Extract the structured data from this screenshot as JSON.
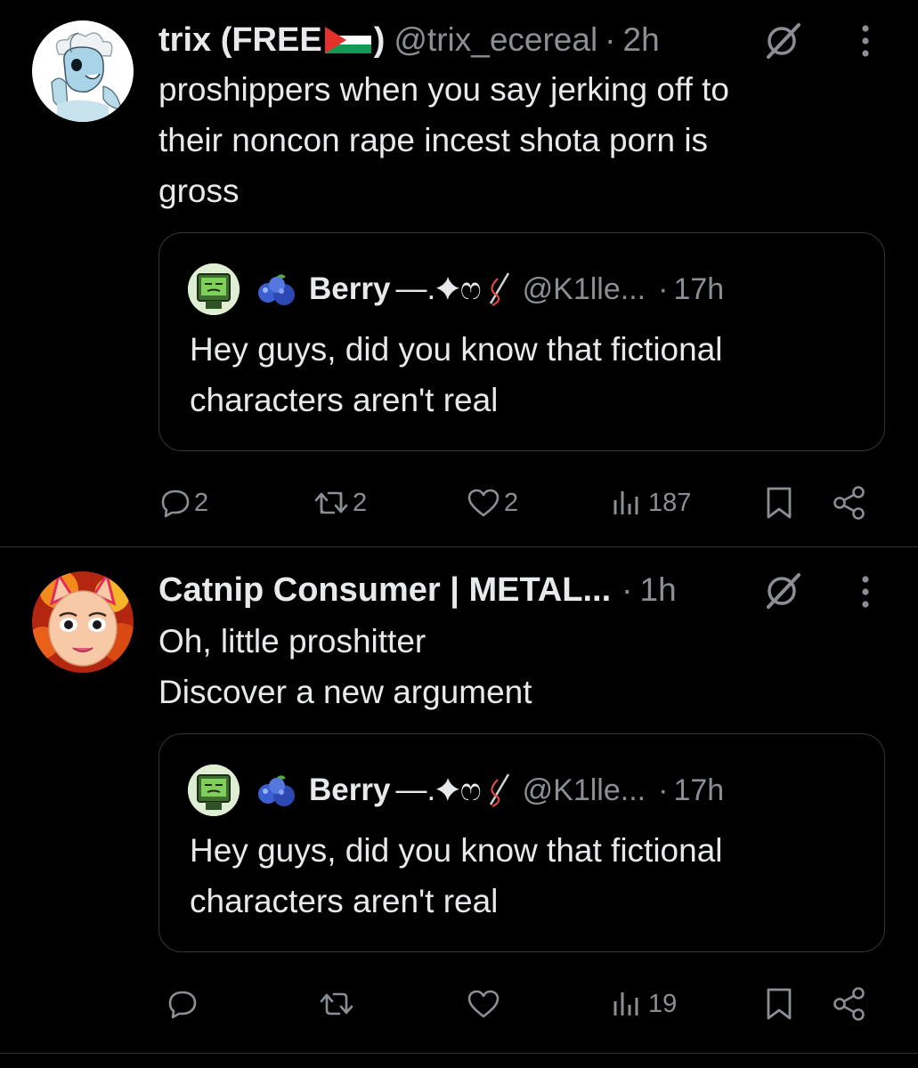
{
  "tweets": [
    {
      "author_name_pre": "trix (FREE",
      "author_name_post": ")",
      "handle": "@trix_ecereal",
      "separator": "·",
      "time": "2h",
      "text_lines": [
        "proshippers when you say jerking off to",
        "their noncon rape incest shota porn is",
        "gross"
      ],
      "quote": {
        "name": "Berry",
        "name_decor": "—.✦ෆ",
        "handle": "@K1lle...",
        "separator": "·",
        "time": "17h",
        "text_lines": [
          "Hey guys, did you know that fictional",
          "characters aren't real"
        ]
      },
      "actions": {
        "replies": "2",
        "reposts": "2",
        "likes": "2",
        "views": "187"
      }
    },
    {
      "author_name": "Catnip Consumer | METAL...",
      "separator": "·",
      "time": "1h",
      "text_lines": [
        "Oh, little proshitter",
        "Discover a new argument"
      ],
      "quote": {
        "name": "Berry",
        "name_decor": "—.✦ෆ",
        "handle": "@K1lle...",
        "separator": "·",
        "time": "17h",
        "text_lines": [
          "Hey guys, did you know that fictional",
          "characters aren't real"
        ]
      },
      "actions": {
        "replies": "",
        "reposts": "",
        "likes": "",
        "views": "19"
      }
    }
  ],
  "icons": {
    "reply": "reply-icon",
    "repost": "repost-icon",
    "like": "heart-icon",
    "views": "views-icon",
    "bookmark": "bookmark-icon",
    "share": "share-icon",
    "grok": "grok-icon",
    "more": "more-icon"
  },
  "colors": {
    "background": "#000000",
    "text": "#e7e9ea",
    "muted": "#8b8f94",
    "border": "#2f3336"
  }
}
